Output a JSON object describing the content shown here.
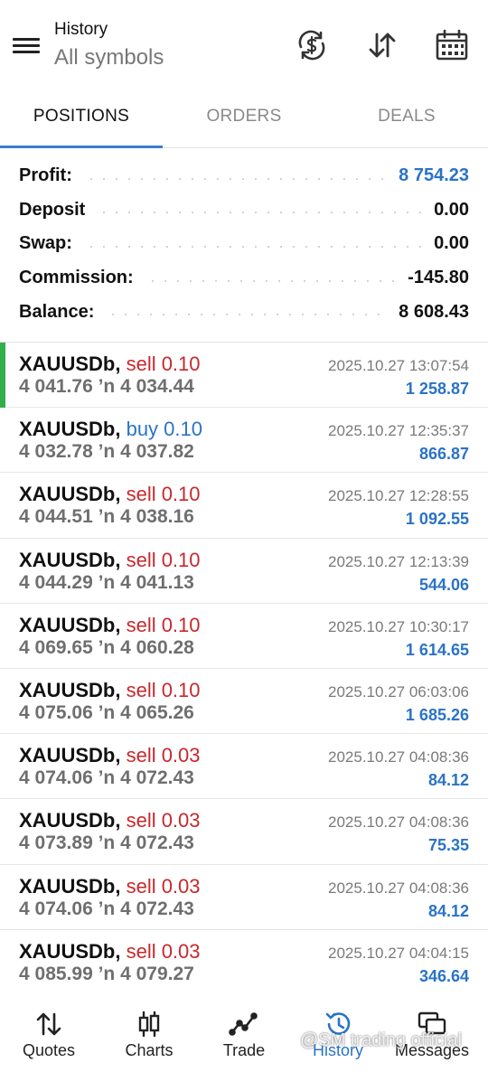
{
  "header": {
    "title": "History",
    "subtitle": "All symbols",
    "icons": [
      "currency-exchange-icon",
      "sort-icon",
      "calendar-icon"
    ]
  },
  "tabs": [
    {
      "label": "POSITIONS",
      "active": true
    },
    {
      "label": "ORDERS",
      "active": false
    },
    {
      "label": "DEALS",
      "active": false
    }
  ],
  "summary": [
    {
      "label": "Profit:",
      "value": "8 754.23",
      "highlight": true
    },
    {
      "label": "Deposit",
      "value": "0.00",
      "highlight": false
    },
    {
      "label": "Swap:",
      "value": "0.00",
      "highlight": false
    },
    {
      "label": "Commission:",
      "value": "-145.80",
      "highlight": false
    },
    {
      "label": "Balance:",
      "value": "8 608.43",
      "highlight": false
    }
  ],
  "deals": [
    {
      "symbol": "XAUUSDb,",
      "side": "sell 0.10",
      "type": "sell",
      "prices": "4 041.76 ’n  4 034.44",
      "datetime": "2025.10.27 13:07:54",
      "profit": "1 258.87",
      "selected": true
    },
    {
      "symbol": "XAUUSDb,",
      "side": "buy 0.10",
      "type": "buy",
      "prices": "4 032.78 ’n  4 037.82",
      "datetime": "2025.10.27 12:35:37",
      "profit": "866.87",
      "selected": false
    },
    {
      "symbol": "XAUUSDb,",
      "side": "sell 0.10",
      "type": "sell",
      "prices": "4 044.51 ’n  4 038.16",
      "datetime": "2025.10.27 12:28:55",
      "profit": "1 092.55",
      "selected": false
    },
    {
      "symbol": "XAUUSDb,",
      "side": "sell 0.10",
      "type": "sell",
      "prices": "4 044.29 ’n  4 041.13",
      "datetime": "2025.10.27 12:13:39",
      "profit": "544.06",
      "selected": false
    },
    {
      "symbol": "XAUUSDb,",
      "side": "sell 0.10",
      "type": "sell",
      "prices": "4 069.65 ’n  4 060.28",
      "datetime": "2025.10.27 10:30:17",
      "profit": "1 614.65",
      "selected": false
    },
    {
      "symbol": "XAUUSDb,",
      "side": "sell 0.10",
      "type": "sell",
      "prices": "4 075.06 ’n  4 065.26",
      "datetime": "2025.10.27 06:03:06",
      "profit": "1 685.26",
      "selected": false
    },
    {
      "symbol": "XAUUSDb,",
      "side": "sell 0.03",
      "type": "sell",
      "prices": "4 074.06 ’n  4 072.43",
      "datetime": "2025.10.27 04:08:36",
      "profit": "84.12",
      "selected": false
    },
    {
      "symbol": "XAUUSDb,",
      "side": "sell 0.03",
      "type": "sell",
      "prices": "4 073.89 ’n  4 072.43",
      "datetime": "2025.10.27 04:08:36",
      "profit": "75.35",
      "selected": false
    },
    {
      "symbol": "XAUUSDb,",
      "side": "sell 0.03",
      "type": "sell",
      "prices": "4 074.06 ’n  4 072.43",
      "datetime": "2025.10.27 04:08:36",
      "profit": "84.12",
      "selected": false
    },
    {
      "symbol": "XAUUSDb,",
      "side": "sell 0.03",
      "type": "sell",
      "prices": "4 085.99 ’n  4 079.27",
      "datetime": "2025.10.27 04:04:15",
      "profit": "346.64",
      "selected": false
    }
  ],
  "nav": [
    {
      "label": "Quotes",
      "icon": "quotes-icon",
      "active": false
    },
    {
      "label": "Charts",
      "icon": "charts-icon",
      "active": false
    },
    {
      "label": "Trade",
      "icon": "trade-icon",
      "active": false
    },
    {
      "label": "History",
      "icon": "history-icon",
      "active": true
    },
    {
      "label": "Messages",
      "icon": "messages-icon",
      "active": false
    }
  ],
  "watermark": "@SM trading official",
  "colors": {
    "accent": "#3a7dd3",
    "profit_blue": "#2a73c7",
    "sell_red": "#c8282d",
    "selected_green": "#2fb04a"
  }
}
